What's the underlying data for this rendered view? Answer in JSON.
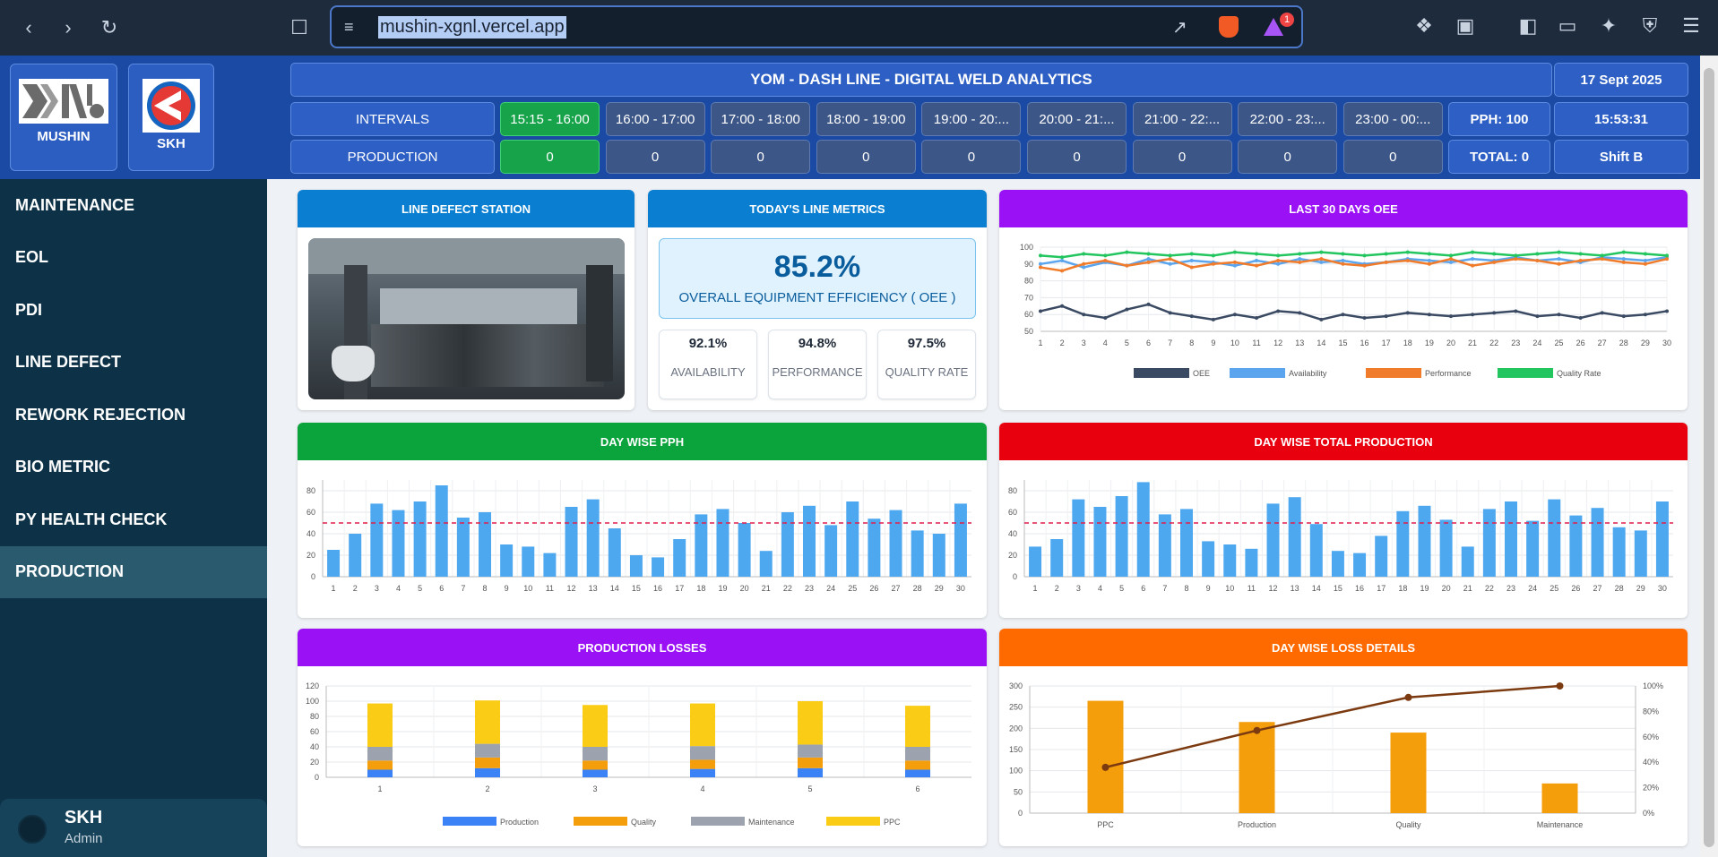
{
  "browser": {
    "url": "mushin-xgnl.vercel.app",
    "notification_count": "1"
  },
  "header": {
    "title": "YOM - DASH LINE - DIGITAL WELD ANALYTICS",
    "date": "17 Sept 2025",
    "time": "15:53:31",
    "shift": "Shift B",
    "logo1_label": "MUSHIN",
    "logo2_label": "SKH",
    "intervals_label": "INTERVALS",
    "production_label": "PRODUCTION",
    "intervals": [
      "15:15 - 16:00",
      "16:00 - 17:00",
      "17:00 - 18:00",
      "18:00 - 19:00",
      "19:00 - 20:...",
      "20:00 - 21:...",
      "21:00 - 22:...",
      "22:00 - 23:...",
      "23:00 - 00:..."
    ],
    "production": [
      "0",
      "0",
      "0",
      "0",
      "0",
      "0",
      "0",
      "0",
      "0"
    ],
    "pph": "PPH: 100",
    "total": "TOTAL: 0"
  },
  "sidebar": {
    "items": [
      "MAINTENANCE",
      "EOL",
      "PDI",
      "LINE DEFECT",
      "REWORK REJECTION",
      "BIO METRIC",
      "PY HEALTH CHECK",
      "PRODUCTION"
    ],
    "active": "PRODUCTION",
    "user_name": "SKH",
    "user_role": "Admin"
  },
  "cards": {
    "line_defect": "LINE DEFECT STATION",
    "metrics": "TODAY'S LINE METRICS",
    "oee30": "LAST 30 DAYS OEE",
    "pph": "DAY WISE PPH",
    "total_prod": "DAY WISE TOTAL PRODUCTION",
    "losses": "PRODUCTION LOSSES",
    "loss_details": "DAY WISE LOSS DETAILS"
  },
  "metrics": {
    "oee_value": "85.2%",
    "oee_label": "OVERALL EQUIPMENT EFFICIENCY ( OEE )",
    "availability_value": "92.1%",
    "availability_label": "AVAILABILITY",
    "performance_value": "94.8%",
    "performance_label": "PERFORMANCE",
    "quality_value": "97.5%",
    "quality_label": "QUALITY RATE"
  },
  "colors": {
    "blue_head": "#0a7fd1",
    "purple_head": "#9b11f5",
    "green_head": "#0aa33c",
    "red_head": "#e8000f",
    "orange_head": "#ff6a00"
  },
  "chart_data": [
    {
      "id": "oee30",
      "type": "line",
      "x": [
        1,
        2,
        3,
        4,
        5,
        6,
        7,
        8,
        9,
        10,
        11,
        12,
        13,
        14,
        15,
        16,
        17,
        18,
        19,
        20,
        21,
        22,
        23,
        24,
        25,
        26,
        27,
        28,
        29,
        30
      ],
      "ylim": [
        50,
        100
      ],
      "yticks": [
        50,
        60,
        70,
        80,
        90,
        100
      ],
      "legend": "bottom",
      "series": [
        {
          "name": "OEE",
          "color": "#3b4a63",
          "values": [
            62,
            65,
            60,
            58,
            63,
            66,
            61,
            59,
            57,
            60,
            58,
            62,
            61,
            57,
            60,
            58,
            59,
            61,
            60,
            59,
            60,
            61,
            62,
            59,
            60,
            58,
            61,
            59,
            60,
            62
          ]
        },
        {
          "name": "Availability",
          "color": "#5aa5ee",
          "values": [
            90,
            92,
            88,
            91,
            89,
            93,
            90,
            92,
            91,
            89,
            92,
            90,
            93,
            91,
            92,
            90,
            91,
            93,
            92,
            91,
            93,
            92,
            94,
            92,
            93,
            91,
            94,
            93,
            92,
            94
          ]
        },
        {
          "name": "Performance",
          "color": "#f07b2b",
          "values": [
            88,
            86,
            90,
            92,
            89,
            91,
            93,
            88,
            90,
            91,
            89,
            92,
            91,
            93,
            90,
            89,
            91,
            92,
            90,
            93,
            89,
            91,
            93,
            92,
            90,
            92,
            93,
            91,
            90,
            93
          ]
        },
        {
          "name": "Quality Rate",
          "color": "#22c55e",
          "values": [
            95,
            94,
            96,
            95,
            97,
            96,
            95,
            96,
            95,
            97,
            96,
            95,
            96,
            97,
            96,
            95,
            96,
            97,
            96,
            95,
            97,
            96,
            95,
            96,
            97,
            96,
            95,
            97,
            96,
            95
          ]
        }
      ]
    },
    {
      "id": "pph",
      "type": "bar",
      "categories": [
        1,
        2,
        3,
        4,
        5,
        6,
        7,
        8,
        9,
        10,
        11,
        12,
        13,
        14,
        15,
        16,
        17,
        18,
        19,
        20,
        21,
        22,
        23,
        24,
        25,
        26,
        27,
        28,
        29,
        30
      ],
      "values": [
        25,
        40,
        68,
        62,
        70,
        85,
        55,
        60,
        30,
        28,
        22,
        65,
        72,
        45,
        20,
        18,
        35,
        58,
        63,
        50,
        24,
        60,
        66,
        48,
        70,
        54,
        62,
        43,
        40,
        68
      ],
      "ylim": [
        0,
        90
      ],
      "yticks": [
        0,
        20,
        40,
        60,
        80
      ],
      "target": 50,
      "color": "#4ea8f0"
    },
    {
      "id": "total_prod",
      "type": "bar",
      "categories": [
        1,
        2,
        3,
        4,
        5,
        6,
        7,
        8,
        9,
        10,
        11,
        12,
        13,
        14,
        15,
        16,
        17,
        18,
        19,
        20,
        21,
        22,
        23,
        24,
        25,
        26,
        27,
        28,
        29,
        30
      ],
      "values": [
        28,
        35,
        72,
        65,
        75,
        88,
        58,
        63,
        33,
        30,
        26,
        68,
        74,
        49,
        24,
        22,
        38,
        61,
        66,
        53,
        28,
        63,
        70,
        52,
        72,
        57,
        64,
        46,
        43,
        70
      ],
      "ylim": [
        0,
        90
      ],
      "yticks": [
        0,
        20,
        40,
        60,
        80
      ],
      "target": 50,
      "color": "#4ea8f0"
    },
    {
      "id": "losses",
      "type": "bar",
      "categories": [
        1,
        2,
        3,
        4,
        5,
        6
      ],
      "ylim": [
        0,
        120
      ],
      "yticks": [
        0,
        20,
        40,
        60,
        80,
        100,
        120
      ],
      "legend": "bottom",
      "series": [
        {
          "name": "Production",
          "color": "#3b82f6",
          "values": [
            10,
            12,
            10,
            11,
            12,
            10
          ]
        },
        {
          "name": "Quality",
          "color": "#f59e0b",
          "values": [
            12,
            14,
            12,
            12,
            14,
            12
          ]
        },
        {
          "name": "Maintenance",
          "color": "#9ca3af",
          "values": [
            18,
            18,
            18,
            18,
            17,
            18
          ]
        },
        {
          "name": "PPC",
          "color": "#facc15",
          "values": [
            57,
            57,
            55,
            56,
            57,
            54
          ]
        }
      ]
    },
    {
      "id": "loss_details",
      "type": "bar",
      "categories": [
        "PPC",
        "Production",
        "Quality",
        "Maintenance"
      ],
      "values": [
        265,
        215,
        190,
        70
      ],
      "ylim": [
        0,
        300
      ],
      "yticks": [
        0,
        50,
        100,
        150,
        200,
        250,
        300
      ],
      "y2ticks": [
        "0%",
        "20%",
        "40%",
        "60%",
        "80%",
        "100%"
      ],
      "cumulative_percent": [
        36,
        65,
        91,
        100
      ],
      "color": "#f59e0b",
      "line_color": "#7c3a10"
    }
  ]
}
